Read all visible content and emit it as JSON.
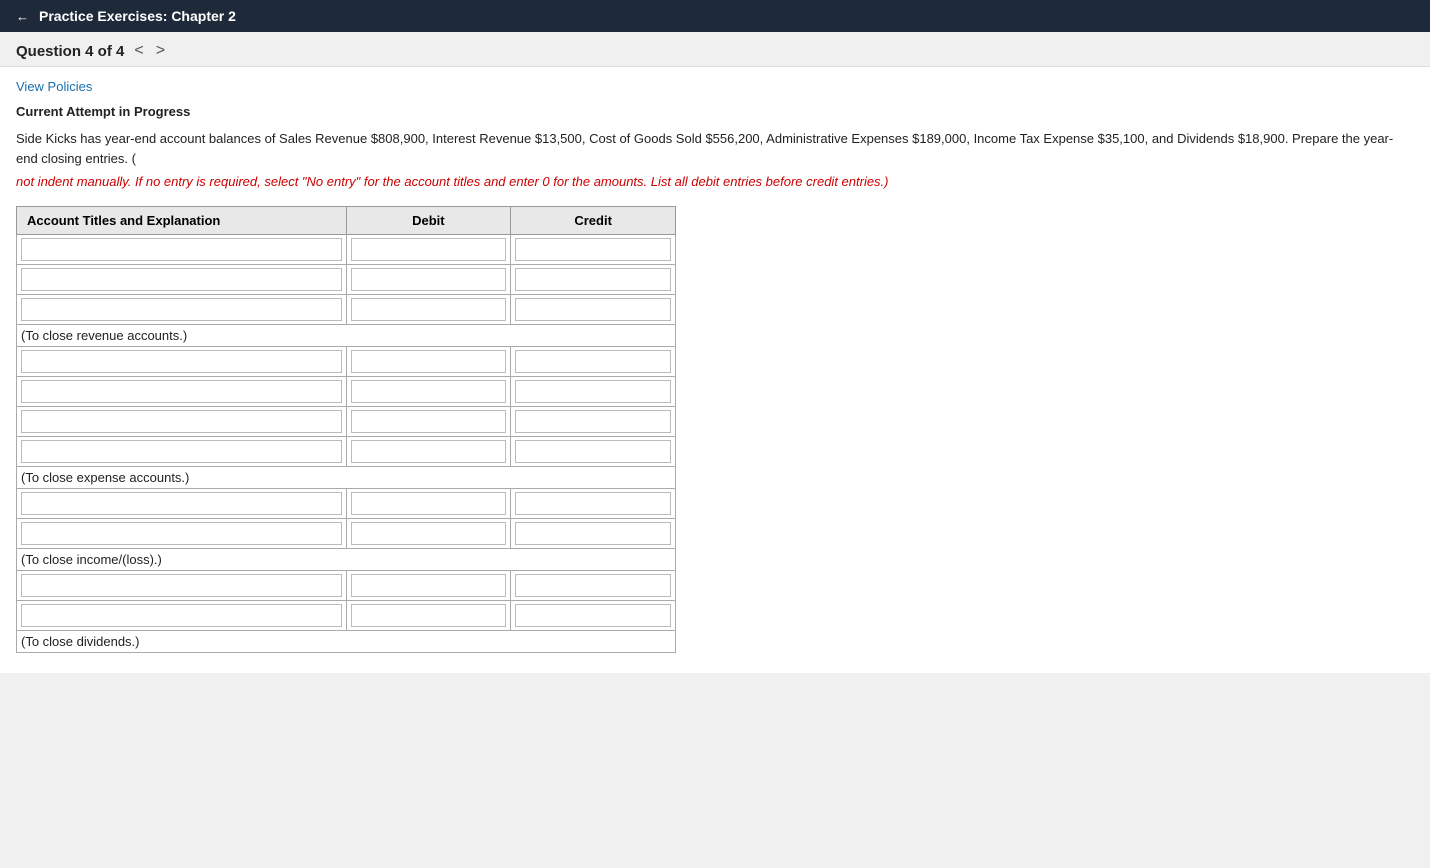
{
  "header": {
    "back_arrow": "←",
    "title": "Practice Exercises: Chapter 2"
  },
  "subheader": {
    "question_label": "Question 4 of 4",
    "prev_arrow": "<",
    "next_arrow": ">"
  },
  "view_policies_link": "View Policies",
  "current_attempt": "Current Attempt in Progress",
  "question_text": "Side Kicks has year-end account balances of Sales Revenue $808,900, Interest Revenue $13,500, Cost of Goods Sold $556,200, Administrative Expenses $189,000, Income Tax Expense $35,100, and Dividends $18,900. Prepare the year-end closing entries. (",
  "question_text_red": "not indent manually. If no entry is required, select \"No entry\" for the account titles and enter 0 for the amounts. List all debit entries before credit entries.)",
  "table": {
    "headers": [
      "Account Titles and Explanation",
      "Debit",
      "Credit"
    ],
    "sections": [
      {
        "rows": 3,
        "note": "(To close revenue accounts.)"
      },
      {
        "rows": 4,
        "note": "(To close expense accounts.)"
      },
      {
        "rows": 2,
        "note": "(To close income/(loss).)"
      },
      {
        "rows": 2,
        "note": "(To close dividends.)"
      }
    ]
  }
}
